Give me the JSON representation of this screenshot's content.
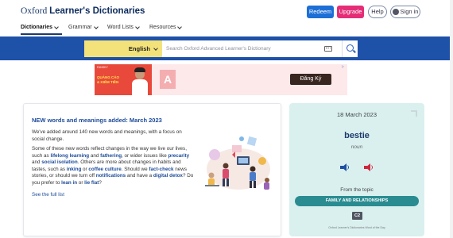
{
  "header": {
    "logo_regular": "Oxford ",
    "logo_bold": "Learner's Dictionaries",
    "redeem_label": "Redeem",
    "upgrade_label": "Upgrade",
    "help_label": "Help",
    "signin_label": "Sign in",
    "colors": {
      "redeem": "#1d6fd6",
      "upgrade": "#e52d77"
    }
  },
  "nav": {
    "items": [
      {
        "label": "Dictionaries",
        "active": true
      },
      {
        "label": "Grammar",
        "active": false
      },
      {
        "label": "Word Lists",
        "active": false
      },
      {
        "label": "Resources",
        "active": false
      }
    ]
  },
  "search": {
    "language": "English",
    "placeholder": "Search Oxford Advanced Learner's Dictionary",
    "band_color": "#1e51a8",
    "language_bg": "#f3e27a"
  },
  "ad": {
    "brand": "FANSKY",
    "headline_line1": "QUẢNG CÁO",
    "headline_line2": "& KIẾM TIỀN",
    "letter": "A",
    "cta": "Đăng Ký"
  },
  "article": {
    "title": "NEW words and meanings added: March 2023",
    "intro": "We've added around 140 new words and meanings, with a focus on social change.",
    "p2": {
      "t1": "Some of these new words reflect changes in the way we live our lives, such as ",
      "b1": "lifelong learning",
      "t2": " and ",
      "b2": "fathering",
      "t3": ", or wider issues like ",
      "b3": "precarity",
      "t4": " and ",
      "b4": "social isolation",
      "t5": ". Others are more about changes in habits and tastes, such as ",
      "b5": "inking",
      "t6": " or ",
      "b6": "coffee culture",
      "t7": ". Should we ",
      "b7": "fact-check",
      "t8": " news stories, or should we turn off ",
      "b8": "notifications",
      "t9": " and have a ",
      "b9": "digital detox",
      "t10": "? Do you prefer to ",
      "b10": "lean in",
      "t11": " or ",
      "b11": "lie flat",
      "t12": "?"
    },
    "full_list_link": "See the full list"
  },
  "word_of_the_day": {
    "date": "18 March 2023",
    "word": "bestie",
    "part_of_speech": "noun",
    "from_topic_label": "From the topic",
    "topic": "FAMILY AND RELATIONSHIPS",
    "level": "C2",
    "footer": "Oxford Learner's Dictionaries Word of the Day",
    "colors": {
      "card_bg": "#d9f0ef",
      "topic_pill": "#2a8c91",
      "uk_audio": "#1d4fa3",
      "us_audio": "#d0263d"
    }
  }
}
